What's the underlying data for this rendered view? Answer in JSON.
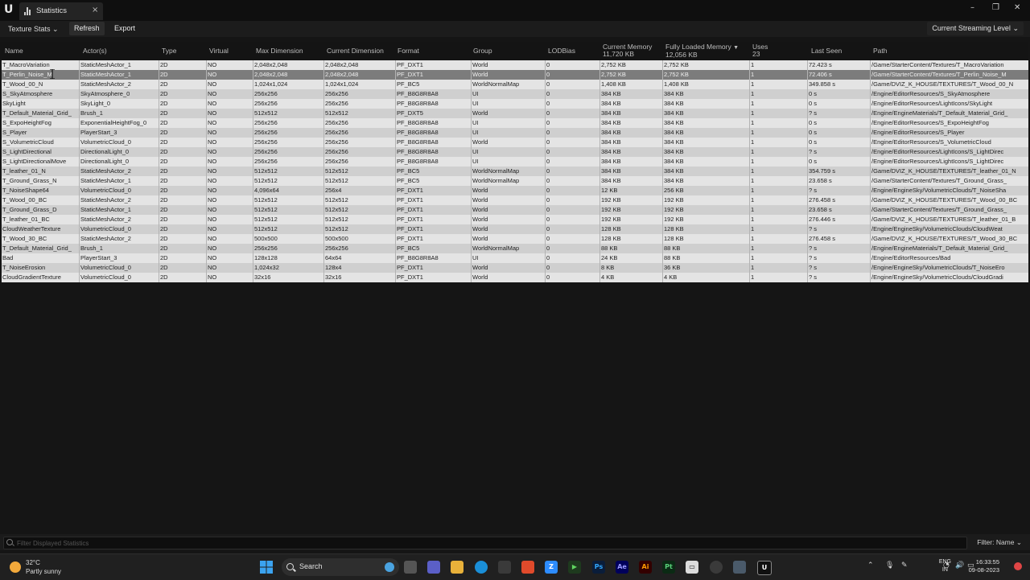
{
  "window": {
    "tab_title": "Statistics",
    "tab_close": "×",
    "minimize": "–",
    "maximize": "❐",
    "close": "✕"
  },
  "toolbar": {
    "stats_dropdown": "Texture Stats",
    "refresh_label": "Refresh",
    "export_label": "Export",
    "streaming_level": "Current Streaming Level"
  },
  "columns": {
    "name": "Name",
    "actors": "Actor(s)",
    "type": "Type",
    "virtual": "Virtual",
    "max_dimension": "Max Dimension",
    "current_dimension": "Current Dimension",
    "format": "Format",
    "group": "Group",
    "lodbias": "LODBias",
    "current_memory": "Current Memory",
    "current_memory_total": "11,720 KB",
    "fully_loaded_memory": "Fully Loaded Memory",
    "fully_loaded_memory_total": "12,056 KB",
    "sort_indicator": "▼",
    "uses": "Uses",
    "uses_total": "23",
    "last_seen": "Last Seen",
    "path": "Path"
  },
  "rows": [
    {
      "name": "T_MacroVariation",
      "actors": "StaticMeshActor_1",
      "type": "2D",
      "virtual": "NO",
      "max": "2,048x2,048",
      "cur": "2,048x2,048",
      "format": "PF_DXT1",
      "group": "World",
      "lod": "0",
      "curmem": "2,752 KB",
      "fullmem": "2,752 KB",
      "uses": "1",
      "seen": "72.423 s",
      "path": "/Game/StarterContent/Textures/T_MacroVariation"
    },
    {
      "name": "T_Perlin_Noise_M",
      "actors": "StaticMeshActor_1",
      "type": "2D",
      "virtual": "NO",
      "max": "2,048x2,048",
      "cur": "2,048x2,048",
      "format": "PF_DXT1",
      "group": "World",
      "lod": "0",
      "curmem": "2,752 KB",
      "fullmem": "2,752 KB",
      "uses": "1",
      "seen": "72.406 s",
      "path": "/Game/StarterContent/Textures/T_Perlin_Noise_M"
    },
    {
      "name": "T_Wood_00_N",
      "actors": "StaticMeshActor_2",
      "type": "2D",
      "virtual": "NO",
      "max": "1,024x1,024",
      "cur": "1,024x1,024",
      "format": "PF_BC5",
      "group": "WorldNormalMap",
      "lod": "0",
      "curmem": "1,408 KB",
      "fullmem": "1,408 KB",
      "uses": "1",
      "seen": "349.858 s",
      "path": "/Game/DVIZ_K_HOUSE/TEXTURES/T_Wood_00_N"
    },
    {
      "name": "S_SkyAtmosphere",
      "actors": "SkyAtmosphere_0",
      "type": "2D",
      "virtual": "NO",
      "max": "256x256",
      "cur": "256x256",
      "format": "PF_B8G8R8A8",
      "group": "UI",
      "lod": "0",
      "curmem": "384 KB",
      "fullmem": "384 KB",
      "uses": "1",
      "seen": "0 s",
      "path": "/Engine/EditorResources/S_SkyAtmosphere"
    },
    {
      "name": "SkyLight",
      "actors": "SkyLight_0",
      "type": "2D",
      "virtual": "NO",
      "max": "256x256",
      "cur": "256x256",
      "format": "PF_B8G8R8A8",
      "group": "UI",
      "lod": "0",
      "curmem": "384 KB",
      "fullmem": "384 KB",
      "uses": "1",
      "seen": "0 s",
      "path": "/Engine/EditorResources/LightIcons/SkyLight"
    },
    {
      "name": "T_Default_Material_Grid_",
      "actors": "Brush_1",
      "type": "2D",
      "virtual": "NO",
      "max": "512x512",
      "cur": "512x512",
      "format": "PF_DXT5",
      "group": "World",
      "lod": "0",
      "curmem": "384 KB",
      "fullmem": "384 KB",
      "uses": "1",
      "seen": "? s",
      "path": "/Engine/EngineMaterials/T_Default_Material_Grid_"
    },
    {
      "name": "S_ExpoHeightFog",
      "actors": "ExponentialHeightFog_0",
      "type": "2D",
      "virtual": "NO",
      "max": "256x256",
      "cur": "256x256",
      "format": "PF_B8G8R8A8",
      "group": "UI",
      "lod": "0",
      "curmem": "384 KB",
      "fullmem": "384 KB",
      "uses": "1",
      "seen": "0 s",
      "path": "/Engine/EditorResources/S_ExpoHeightFog"
    },
    {
      "name": "S_Player",
      "actors": "PlayerStart_3",
      "type": "2D",
      "virtual": "NO",
      "max": "256x256",
      "cur": "256x256",
      "format": "PF_B8G8R8A8",
      "group": "UI",
      "lod": "0",
      "curmem": "384 KB",
      "fullmem": "384 KB",
      "uses": "1",
      "seen": "0 s",
      "path": "/Engine/EditorResources/S_Player"
    },
    {
      "name": "S_VolumetricCloud",
      "actors": "VolumetricCloud_0",
      "type": "2D",
      "virtual": "NO",
      "max": "256x256",
      "cur": "256x256",
      "format": "PF_B8G8R8A8",
      "group": "World",
      "lod": "0",
      "curmem": "384 KB",
      "fullmem": "384 KB",
      "uses": "1",
      "seen": "0 s",
      "path": "/Engine/EditorResources/S_VolumetricCloud"
    },
    {
      "name": "S_LightDirectional",
      "actors": "DirectionalLight_0",
      "type": "2D",
      "virtual": "NO",
      "max": "256x256",
      "cur": "256x256",
      "format": "PF_B8G8R8A8",
      "group": "UI",
      "lod": "0",
      "curmem": "384 KB",
      "fullmem": "384 KB",
      "uses": "1",
      "seen": "? s",
      "path": "/Engine/EditorResources/LightIcons/S_LightDirec"
    },
    {
      "name": "S_LightDirectionalMove",
      "actors": "DirectionalLight_0",
      "type": "2D",
      "virtual": "NO",
      "max": "256x256",
      "cur": "256x256",
      "format": "PF_B8G8R8A8",
      "group": "UI",
      "lod": "0",
      "curmem": "384 KB",
      "fullmem": "384 KB",
      "uses": "1",
      "seen": "0 s",
      "path": "/Engine/EditorResources/LightIcons/S_LightDirec"
    },
    {
      "name": "T_leather_01_N",
      "actors": "StaticMeshActor_2",
      "type": "2D",
      "virtual": "NO",
      "max": "512x512",
      "cur": "512x512",
      "format": "PF_BC5",
      "group": "WorldNormalMap",
      "lod": "0",
      "curmem": "384 KB",
      "fullmem": "384 KB",
      "uses": "1",
      "seen": "354.759 s",
      "path": "/Game/DVIZ_K_HOUSE/TEXTURES/T_leather_01_N"
    },
    {
      "name": "T_Ground_Grass_N",
      "actors": "StaticMeshActor_1",
      "type": "2D",
      "virtual": "NO",
      "max": "512x512",
      "cur": "512x512",
      "format": "PF_BC5",
      "group": "WorldNormalMap",
      "lod": "0",
      "curmem": "384 KB",
      "fullmem": "384 KB",
      "uses": "1",
      "seen": "23.658 s",
      "path": "/Game/StarterContent/Textures/T_Ground_Grass_"
    },
    {
      "name": "T_NoiseShape64",
      "actors": "VolumetricCloud_0",
      "type": "2D",
      "virtual": "NO",
      "max": "4,096x64",
      "cur": "256x4",
      "format": "PF_DXT1",
      "group": "World",
      "lod": "0",
      "curmem": "12 KB",
      "fullmem": "256 KB",
      "uses": "1",
      "seen": "? s",
      "path": "/Engine/EngineSky/VolumetricClouds/T_NoiseSha"
    },
    {
      "name": "T_Wood_00_BC",
      "actors": "StaticMeshActor_2",
      "type": "2D",
      "virtual": "NO",
      "max": "512x512",
      "cur": "512x512",
      "format": "PF_DXT1",
      "group": "World",
      "lod": "0",
      "curmem": "192 KB",
      "fullmem": "192 KB",
      "uses": "1",
      "seen": "276.458 s",
      "path": "/Game/DVIZ_K_HOUSE/TEXTURES/T_Wood_00_BC"
    },
    {
      "name": "T_Ground_Grass_D",
      "actors": "StaticMeshActor_1",
      "type": "2D",
      "virtual": "NO",
      "max": "512x512",
      "cur": "512x512",
      "format": "PF_DXT1",
      "group": "World",
      "lod": "0",
      "curmem": "192 KB",
      "fullmem": "192 KB",
      "uses": "1",
      "seen": "23.658 s",
      "path": "/Game/StarterContent/Textures/T_Ground_Grass_"
    },
    {
      "name": "T_leather_01_BC",
      "actors": "StaticMeshActor_2",
      "type": "2D",
      "virtual": "NO",
      "max": "512x512",
      "cur": "512x512",
      "format": "PF_DXT1",
      "group": "World",
      "lod": "0",
      "curmem": "192 KB",
      "fullmem": "192 KB",
      "uses": "1",
      "seen": "276.446 s",
      "path": "/Game/DVIZ_K_HOUSE/TEXTURES/T_leather_01_B"
    },
    {
      "name": "CloudWeatherTexture",
      "actors": "VolumetricCloud_0",
      "type": "2D",
      "virtual": "NO",
      "max": "512x512",
      "cur": "512x512",
      "format": "PF_DXT1",
      "group": "World",
      "lod": "0",
      "curmem": "128 KB",
      "fullmem": "128 KB",
      "uses": "1",
      "seen": "? s",
      "path": "/Engine/EngineSky/VolumetricClouds/CloudWeat"
    },
    {
      "name": "T_Wood_30_BC",
      "actors": "StaticMeshActor_2",
      "type": "2D",
      "virtual": "NO",
      "max": "500x500",
      "cur": "500x500",
      "format": "PF_DXT1",
      "group": "World",
      "lod": "0",
      "curmem": "128 KB",
      "fullmem": "128 KB",
      "uses": "1",
      "seen": "276.458 s",
      "path": "/Game/DVIZ_K_HOUSE/TEXTURES/T_Wood_30_BC"
    },
    {
      "name": "T_Default_Material_Grid_",
      "actors": "Brush_1",
      "type": "2D",
      "virtual": "NO",
      "max": "256x256",
      "cur": "256x256",
      "format": "PF_BC5",
      "group": "WorldNormalMap",
      "lod": "0",
      "curmem": "88 KB",
      "fullmem": "88 KB",
      "uses": "1",
      "seen": "? s",
      "path": "/Engine/EngineMaterials/T_Default_Material_Grid_"
    },
    {
      "name": "Bad",
      "actors": "PlayerStart_3",
      "type": "2D",
      "virtual": "NO",
      "max": "128x128",
      "cur": "64x64",
      "format": "PF_B8G8R8A8",
      "group": "UI",
      "lod": "0",
      "curmem": "24 KB",
      "fullmem": "88 KB",
      "uses": "1",
      "seen": "? s",
      "path": "/Engine/EditorResources/Bad"
    },
    {
      "name": "T_NoiseErosion",
      "actors": "VolumetricCloud_0",
      "type": "2D",
      "virtual": "NO",
      "max": "1,024x32",
      "cur": "128x4",
      "format": "PF_DXT1",
      "group": "World",
      "lod": "0",
      "curmem": "8 KB",
      "fullmem": "36 KB",
      "uses": "1",
      "seen": "? s",
      "path": "/Engine/EngineSky/VolumetricClouds/T_NoiseEro"
    },
    {
      "name": "CloudGradientTexture",
      "actors": "VolumetricCloud_0",
      "type": "2D",
      "virtual": "NO",
      "max": "32x16",
      "cur": "32x16",
      "format": "PF_DXT1",
      "group": "World",
      "lod": "0",
      "curmem": "4 KB",
      "fullmem": "4 KB",
      "uses": "1",
      "seen": "? s",
      "path": "/Engine/EngineSky/VolumetricClouds/CloudGradi"
    }
  ],
  "bottom": {
    "filter_placeholder": "Filter Displayed Statistics",
    "filter_name": "Filter: Name"
  },
  "taskbar": {
    "temperature": "32°C",
    "weather": "Partly sunny",
    "search": "Search",
    "lang_top": "ENG",
    "lang_bottom": "IN",
    "time": "16:33:55",
    "date": "09-08-2023"
  }
}
